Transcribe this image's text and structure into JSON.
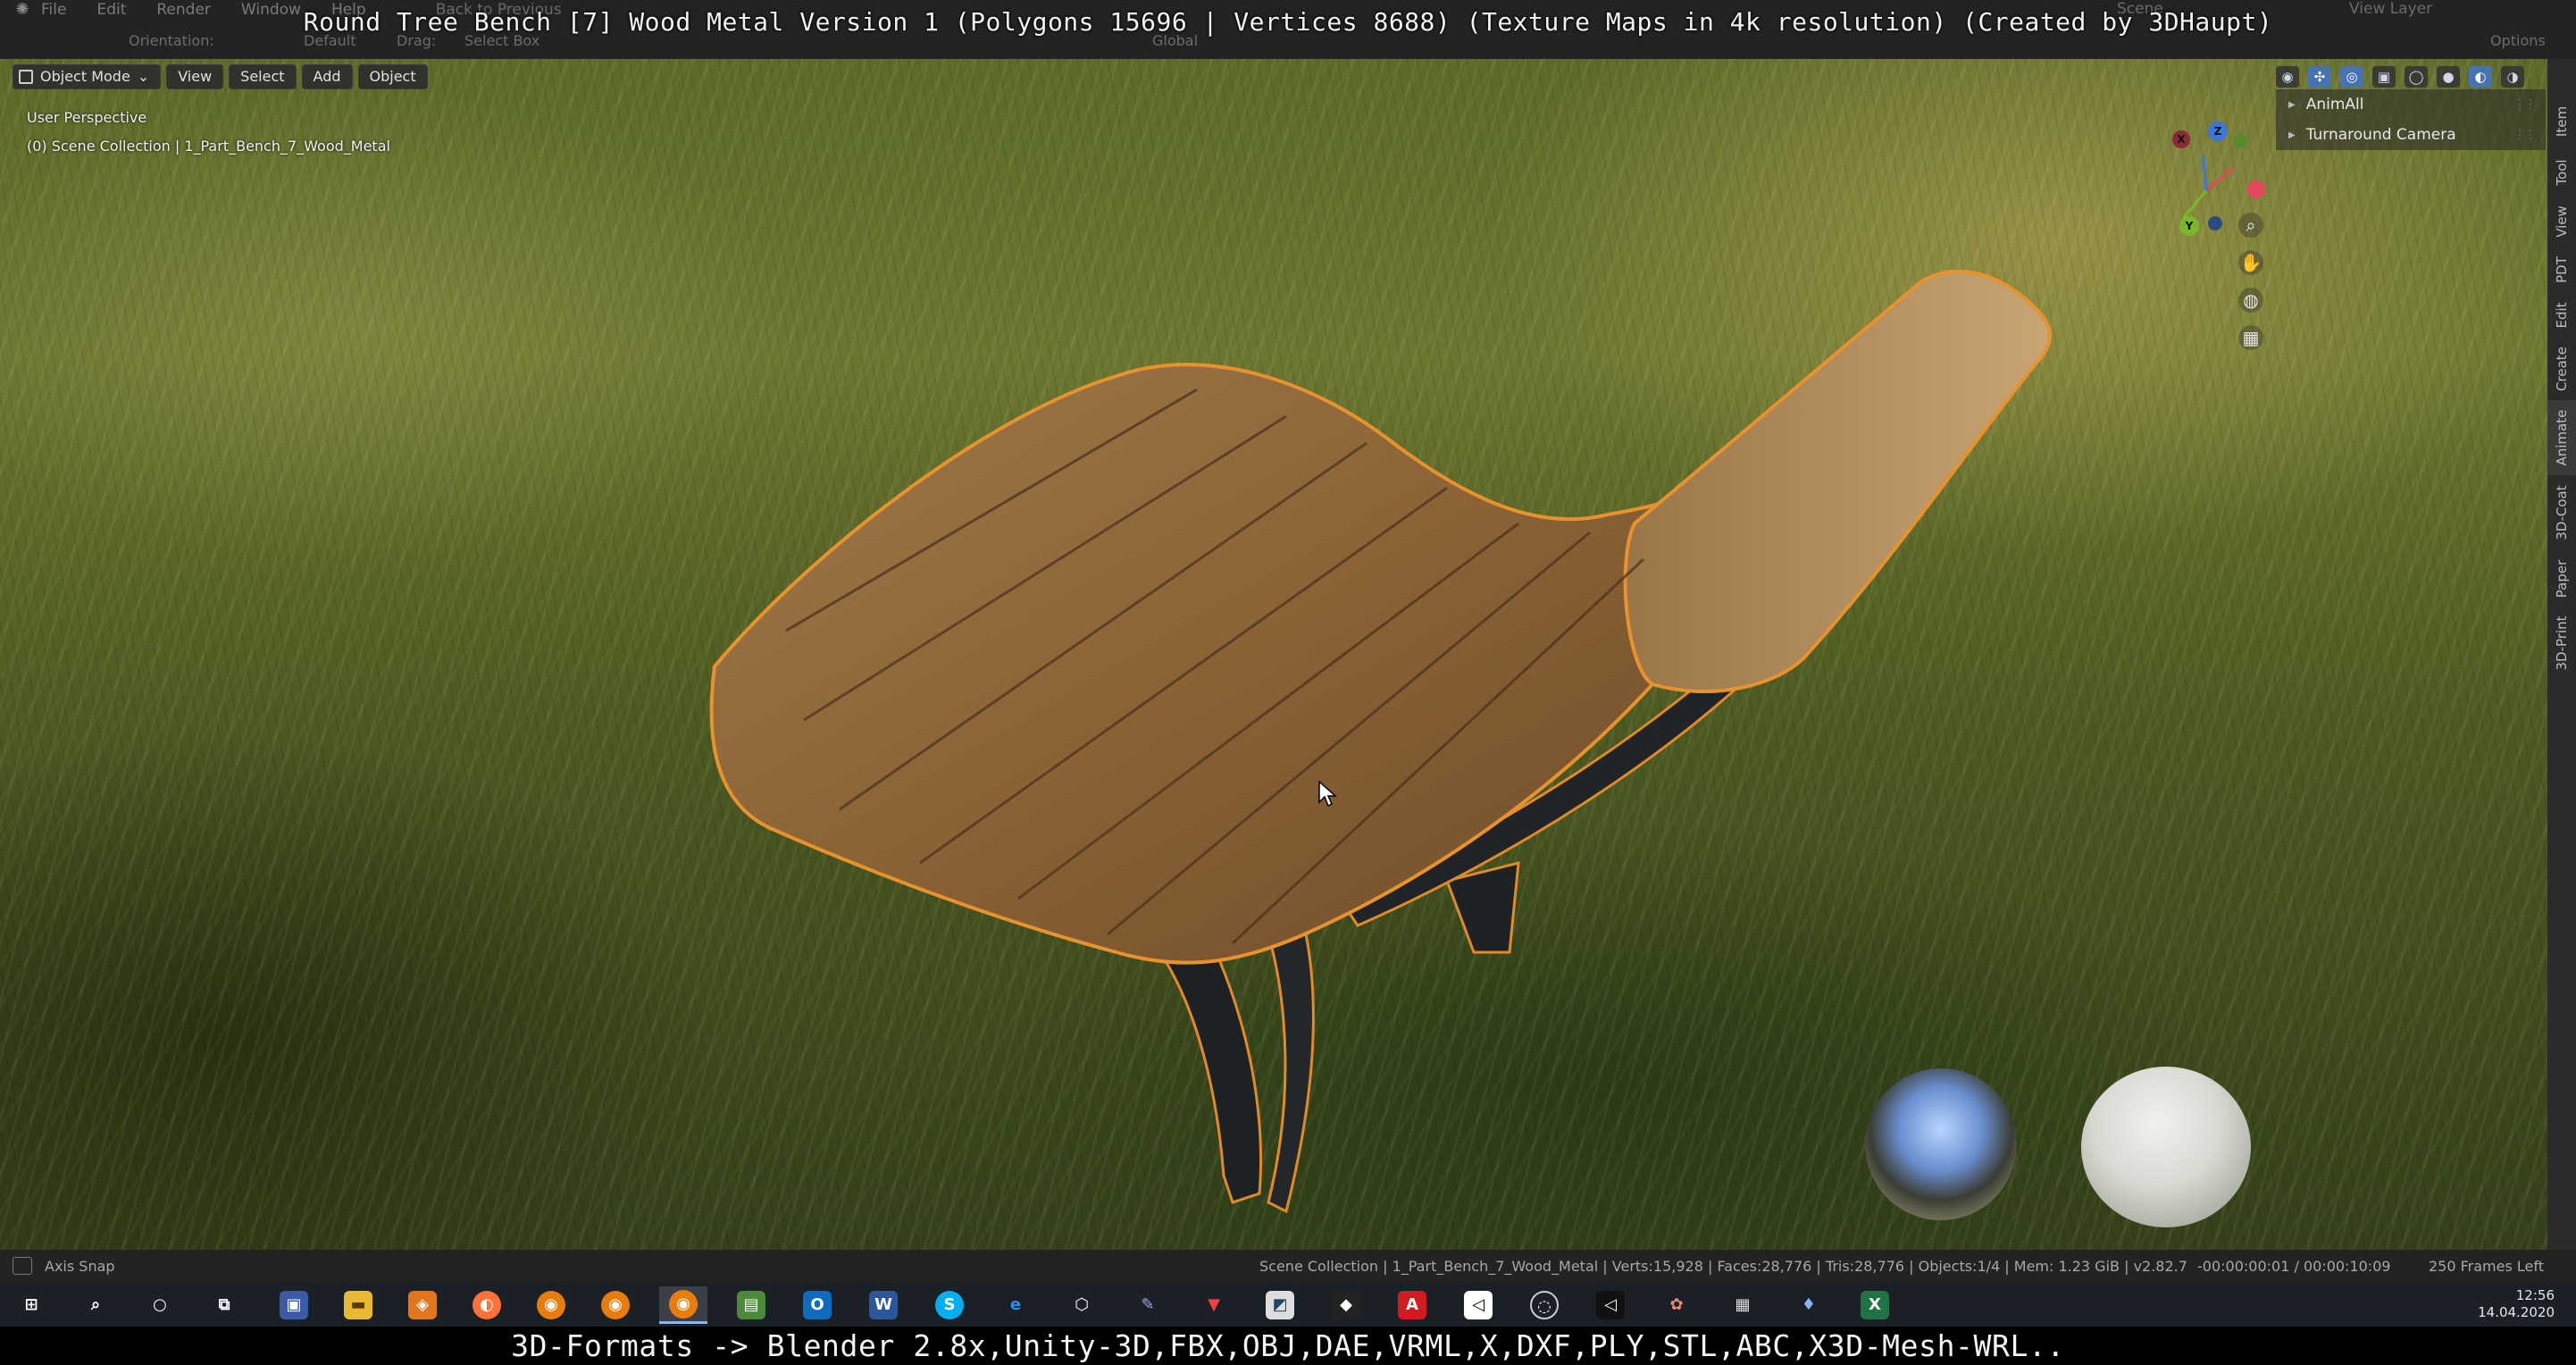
{
  "menubar": {
    "items": [
      "File",
      "Edit",
      "Render",
      "Window",
      "Help"
    ],
    "back_label": "Back to Previous",
    "scene": "Scene",
    "view_layer": "View Layer"
  },
  "toolrow": {
    "orientation": "Orientation:",
    "default": "Default",
    "drag": "Drag:",
    "select_box": "Select Box",
    "global": "Global",
    "options": "Options"
  },
  "title_overlay": "Round Tree Bench [7] Wood Metal Version 1 (Polygons 15696 | Vertices 8688) (Texture Maps in 4k resolution) (Created by 3DHaupt)",
  "viewport": {
    "mode": "Object Mode",
    "menu": [
      "View",
      "Select",
      "Add",
      "Object"
    ],
    "perspective": "User Perspective",
    "collection": "(0) Scene Collection | 1_Part_Bench_7_Wood_Metal"
  },
  "gizmo": {
    "x": "X",
    "y": "Y",
    "z": "Z"
  },
  "side_panel": {
    "rows": [
      "AnimAll",
      "Turnaround Camera"
    ]
  },
  "vtabs": [
    "Item",
    "Tool",
    "View",
    "PDT",
    "Edit",
    "Create",
    "Animate",
    "3D-Coat",
    "Paper",
    "3D-Print"
  ],
  "statusbar": {
    "left": "Axis Snap",
    "stats": "Scene Collection | 1_Part_Bench_7_Wood_Metal | Verts:15,928 | Faces:28,776 | Tris:28,776 | Objects:1/4 | Mem: 1.23 GiB | v2.82.7",
    "time": "-00:00:00:01 / 00:00:10:09",
    "frames": "250 Frames Left"
  },
  "taskbar": {
    "icons": [
      "windows-start",
      "search",
      "cortana",
      "task-view",
      "save",
      "file-explorer",
      "blender-fire",
      "firefox",
      "blender",
      "blender",
      "blender",
      "spreadsheet",
      "outlook",
      "word",
      "skype",
      "edge",
      "3d-viewer",
      "app",
      "vectornator",
      "app",
      "affinity",
      "acrobat",
      "unity",
      "obs",
      "unity",
      "paint",
      "calculator",
      "maps",
      "excel"
    ],
    "time": "12:56",
    "date": "14.04.2020"
  },
  "caption": "3D-Formats -> Blender 2.8x,Unity-3D,FBX,OBJ,DAE,VRML,X,DXF,PLY,STL,ABC,X3D-Mesh-WRL.."
}
